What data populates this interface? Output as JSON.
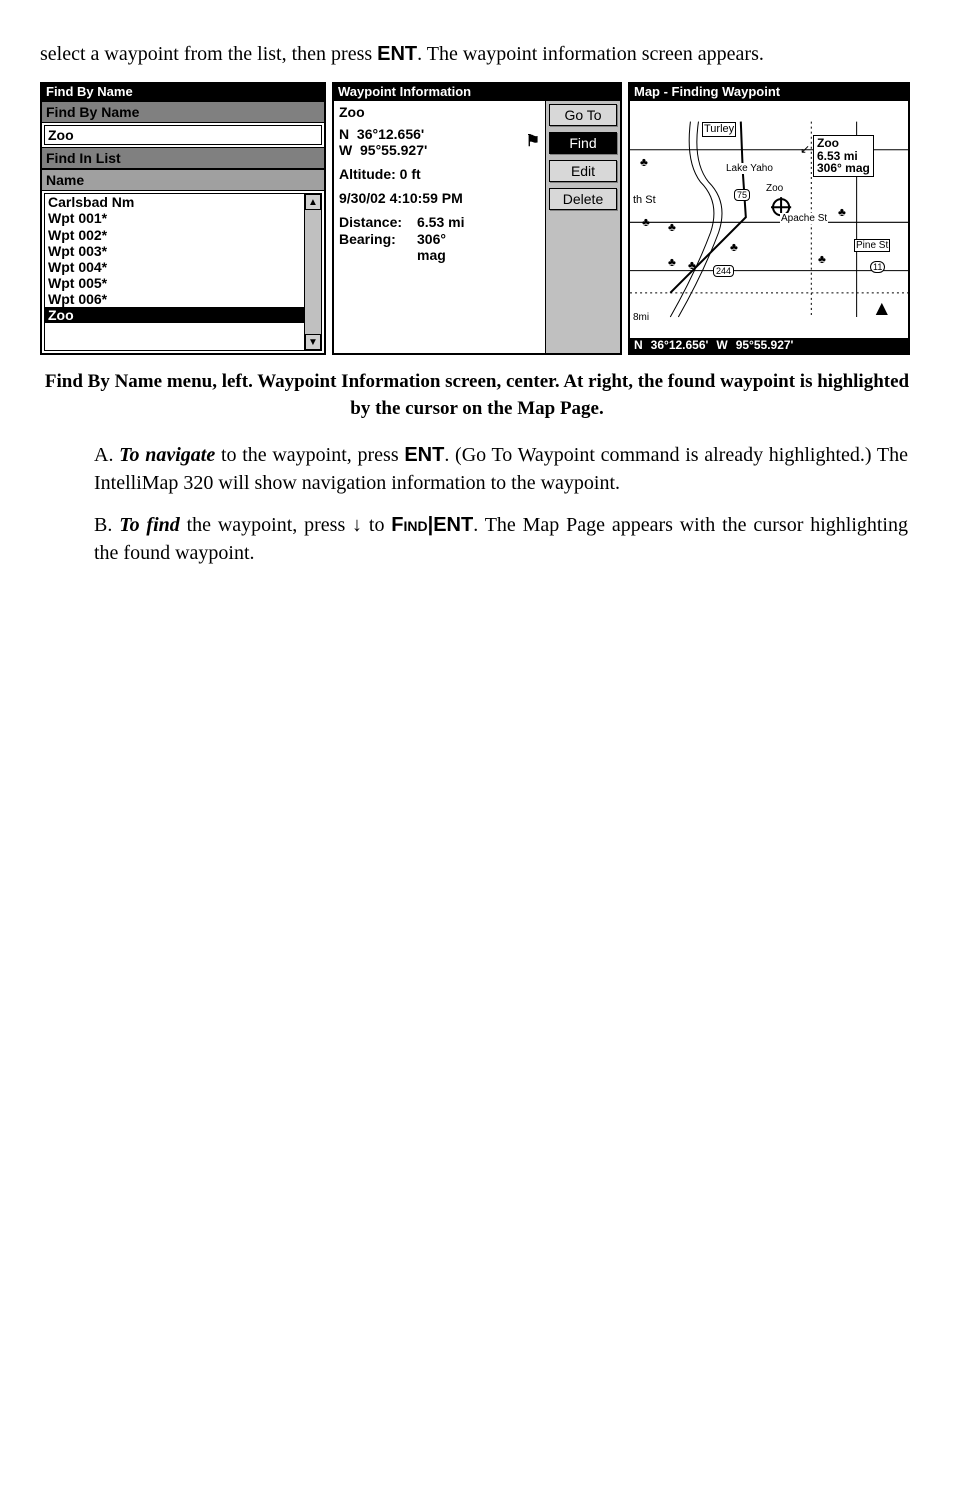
{
  "intro": {
    "a": "select a waypoint from the list, then press ",
    "ent": "ENT",
    "b": ". The waypoint information screen appears."
  },
  "s1": {
    "titlebar": "Find By Name",
    "header": "Find By Name",
    "nameValue": "Zoo",
    "listHeader": "Find In List",
    "col": "Name",
    "items": [
      "Carlsbad Nm",
      "Wpt 001*",
      "Wpt 002*",
      "Wpt 003*",
      "Wpt 004*",
      "Wpt 005*",
      "Wpt 006*",
      "Zoo"
    ]
  },
  "s2": {
    "titlebar": "Waypoint Information",
    "name": "Zoo",
    "latLabel": "N",
    "lat": "36°12.656'",
    "lonLabel": "W",
    "lon": "95°55.927'",
    "altLabel": "Altitude:",
    "alt": "0 ft",
    "timestamp": "9/30/02 4:10:59 PM",
    "distLabel": "Distance:",
    "dist": "6.53 mi",
    "bearLabel": "Bearing:",
    "bear": "306°",
    "bearUnit": "mag",
    "buttons": {
      "goto": "Go To",
      "find": "Find",
      "edit": "Edit",
      "delete": "Delete"
    }
  },
  "s3": {
    "titlebar": "Map - Finding Waypoint",
    "callout1": "Zoo",
    "callout2": "6.53 mi",
    "callout3": "306° mag",
    "labels": {
      "turley": "Turley",
      "lake": "Lake Yaho",
      "thst": "th St",
      "zoo": "Zoo",
      "apache": "Apache St",
      "pine": "Pine St",
      "hwy75": "75",
      "hwy244": "244",
      "hwy11": "11",
      "scale": "8mi"
    },
    "footer": {
      "n": "N",
      "lat": "36°12.656'",
      "w": "W",
      "lon": "95°55.927'"
    }
  },
  "caption": "Find By Name menu, left. Waypoint Information screen, center. At right, the found waypoint is highlighted by the cursor on the Map Page.",
  "paraA": {
    "lead": "A. ",
    "nav": "To navigate",
    "a": " to the waypoint, press ",
    "ent": "ENT",
    "b": ". (Go To Waypoint command is already highlighted.) The IntelliMap 320 will show navigation information to the waypoint."
  },
  "paraB": {
    "lead": "B. ",
    "find": "To find",
    "a": " the waypoint, press ↓ to ",
    "cmd": "Find",
    "bar": "|",
    "ent": "ENT",
    "b": ". The Map Page appears with the cursor highlighting the found waypoint."
  }
}
